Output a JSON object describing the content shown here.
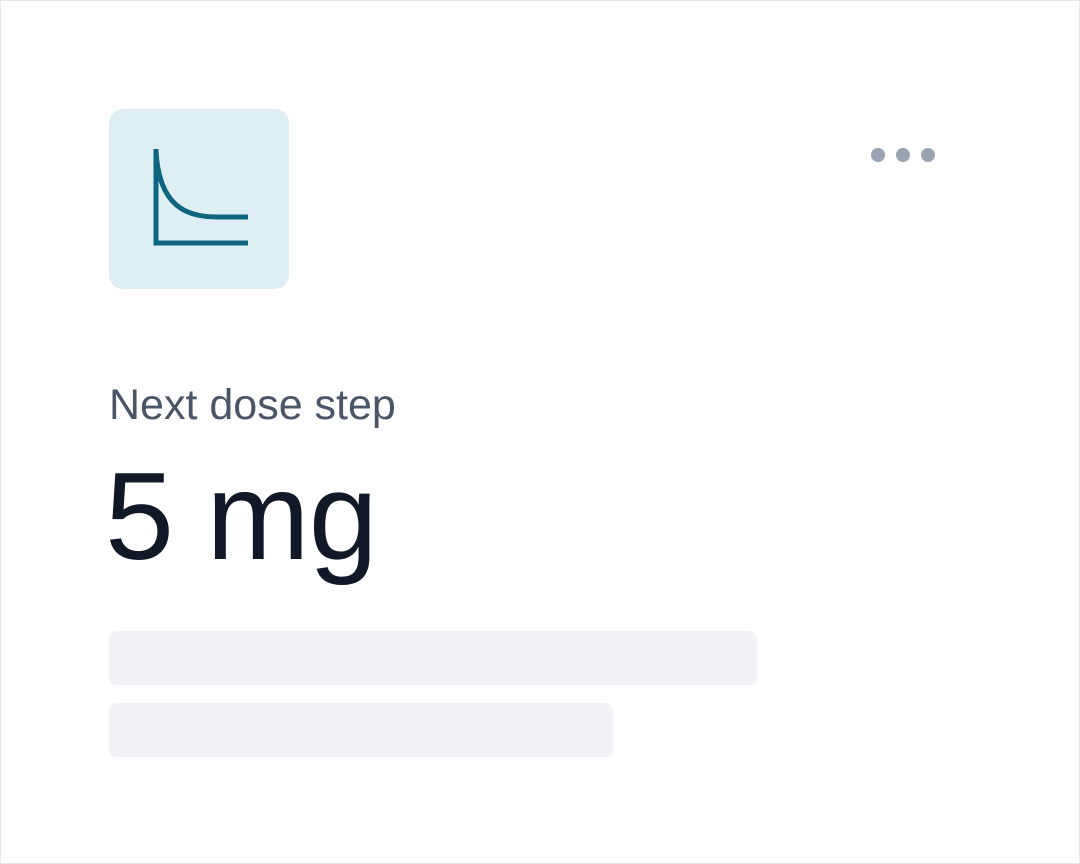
{
  "card": {
    "icon": "decay-curve-icon",
    "menu_icon": "more-horizontal-icon",
    "label": "Next dose step",
    "value": "5 mg"
  },
  "colors": {
    "icon_bg": "#dfeef3",
    "icon_stroke": "#0e6580",
    "label": "#4b5568",
    "value": "#111827",
    "dots": "#9aa3b2",
    "skeleton": "#f1f2f5"
  }
}
